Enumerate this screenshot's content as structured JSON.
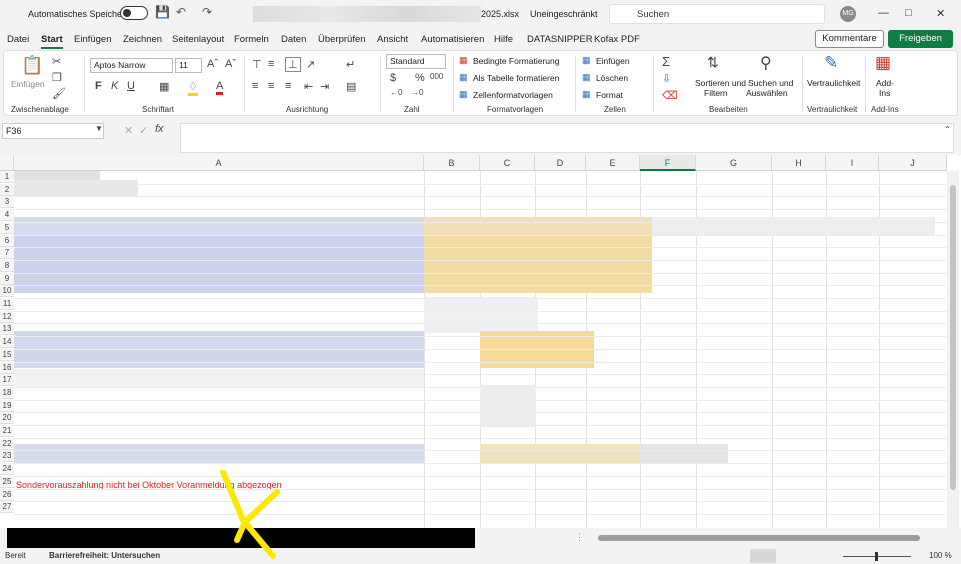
{
  "titlebar": {
    "autosave_label": "Automatisches Speichern",
    "filename": "2025.xlsx",
    "restriction": "Uneingeschränkt",
    "search_placeholder": "Suchen",
    "avatar_initials": "MG"
  },
  "tabs": [
    "Datei",
    "Start",
    "Einfügen",
    "Zeichnen",
    "Seitenlayout",
    "Formeln",
    "Daten",
    "Überprüfen",
    "Ansicht",
    "Automatisieren",
    "Hilfe",
    "DATASNIPPER",
    "Kofax PDF"
  ],
  "active_tab": "Start",
  "buttons": {
    "comments": "Kommentare",
    "share": "Freigeben"
  },
  "ribbon": {
    "clipboard": {
      "paste": "Einfügen",
      "label": "Zwischenablage"
    },
    "font": {
      "name": "Aptos Narrow",
      "size": "11",
      "label": "Schriftart"
    },
    "alignment": {
      "label": "Ausrichtung"
    },
    "number": {
      "format": "Standard",
      "label": "Zahl"
    },
    "styles": {
      "conditional": "Bedingte Formatierung",
      "as_table": "Als Tabelle formatieren",
      "cell_styles": "Zellenformatvorlagen",
      "label": "Formatvorlagen"
    },
    "cells": {
      "insert": "Einfügen",
      "delete": "Löschen",
      "format": "Format",
      "label": "Zellen"
    },
    "editing": {
      "sort_1": "Sortieren und",
      "sort_2": "Filtern",
      "find_1": "Suchen und",
      "find_2": "Auswählen",
      "label": "Bearbeiten"
    },
    "sensitivity": {
      "btn": "Vertraulichkeit",
      "label": "Vertraulichkeit"
    },
    "addins": {
      "btn_1": "Add-",
      "btn_2": "Ins",
      "label": "Add-Ins"
    }
  },
  "formula_bar": {
    "cell_ref": "F36",
    "fx": "fx"
  },
  "grid": {
    "columns": [
      "A",
      "B",
      "C",
      "D",
      "E",
      "F",
      "G",
      "H",
      "I",
      "J"
    ],
    "selected_column": "F",
    "rows": [
      "1",
      "2",
      "3",
      "4",
      "5",
      "6",
      "7",
      "8",
      "9",
      "10",
      "11",
      "12",
      "13",
      "14",
      "15",
      "16",
      "17",
      "18",
      "19",
      "20",
      "21",
      "22",
      "23",
      "24",
      "25",
      "26",
      "27"
    ],
    "note_text": "Sondervorauszahlung nicht bei Oktober Voranmeldung abgezogen"
  },
  "status": {
    "ready": "Bereit",
    "accessibility": "Barrierefreiheit: Untersuchen",
    "zoom": "100 %"
  },
  "colors": {
    "accent": "#107c41",
    "note": "#e02020"
  }
}
